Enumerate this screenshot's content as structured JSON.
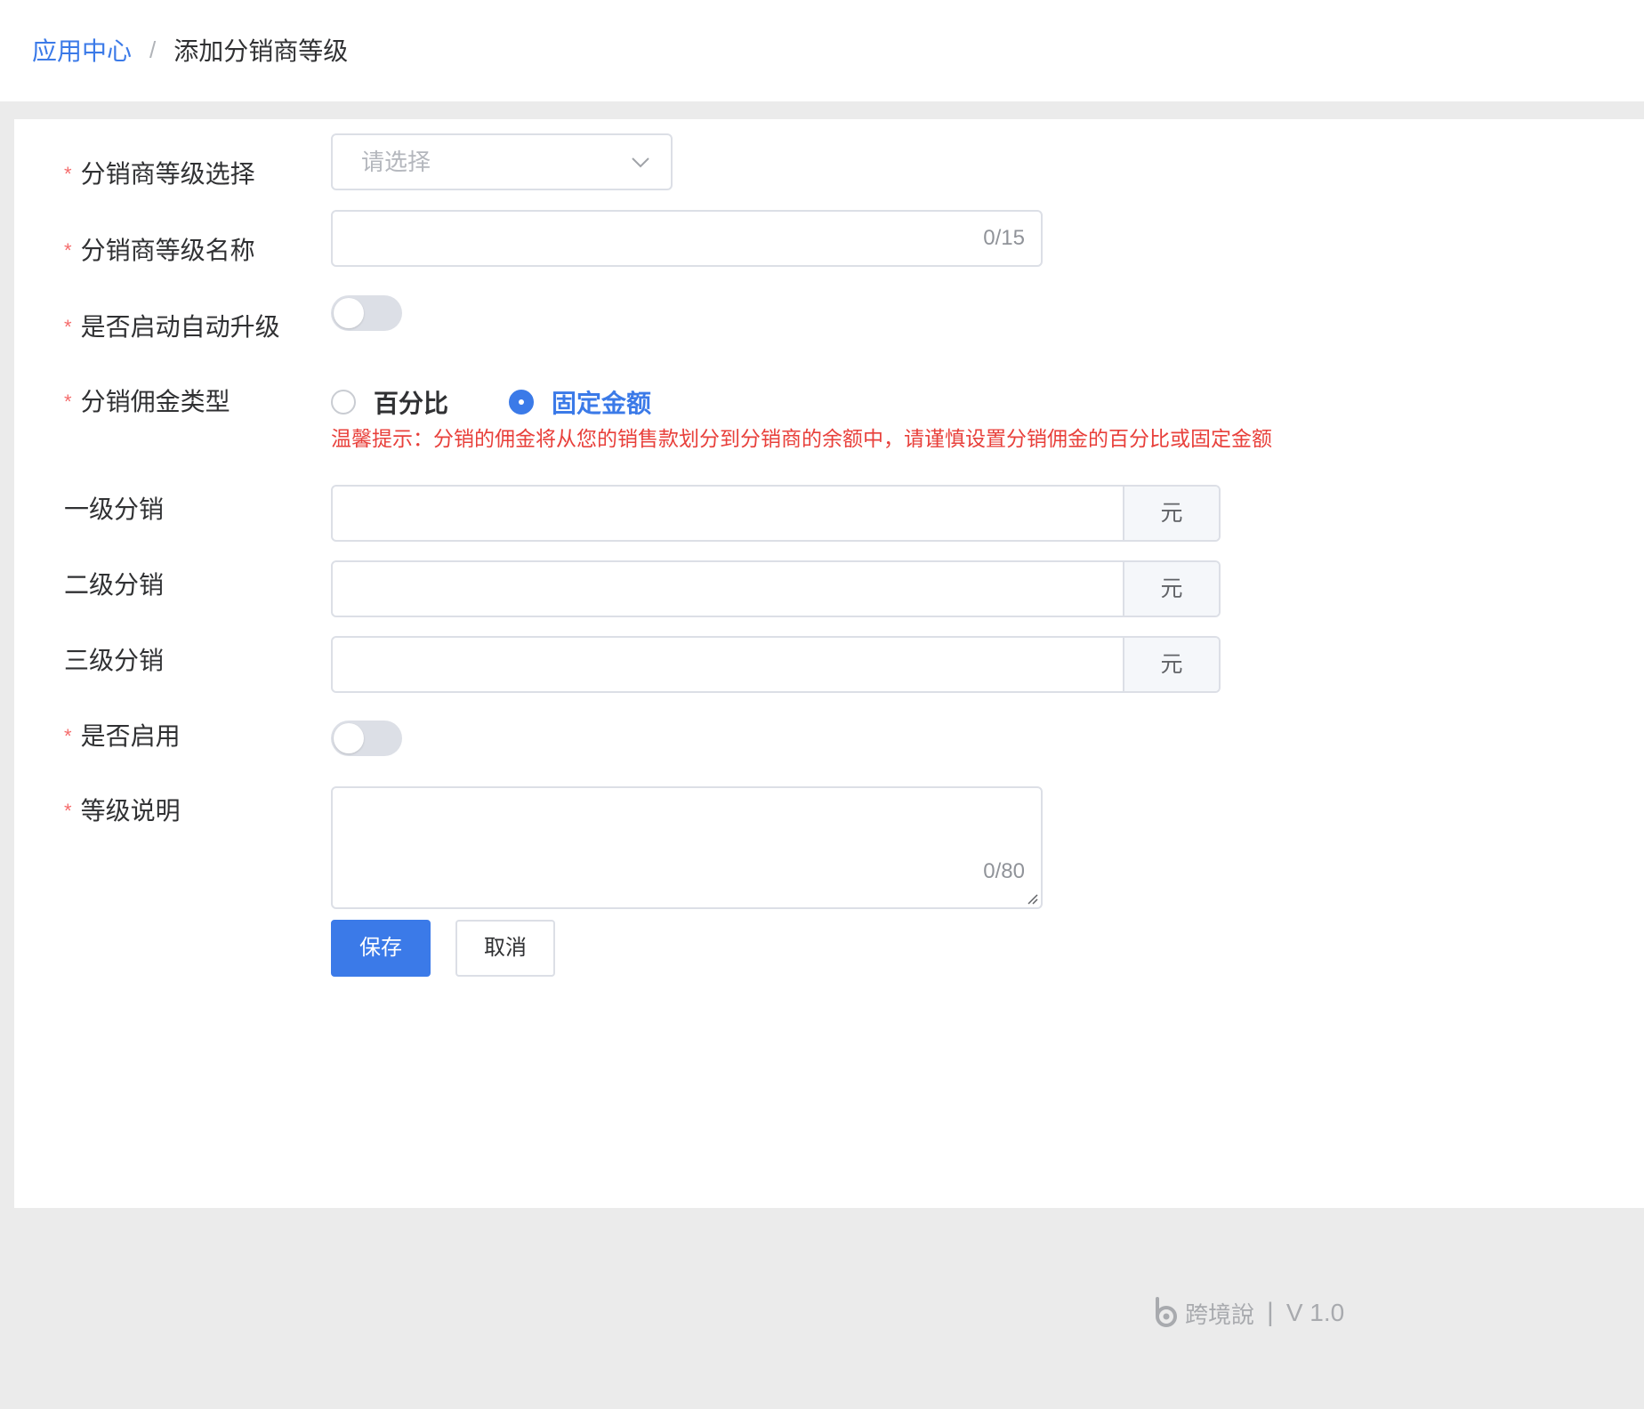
{
  "breadcrumb": {
    "parent": "应用中心",
    "separator": "/",
    "current": "添加分销商等级"
  },
  "form": {
    "required_mark": "*",
    "level_select": {
      "label": "分销商等级选择",
      "placeholder": "请选择"
    },
    "level_name": {
      "label": "分销商等级名称",
      "value": "",
      "counter": "0/15"
    },
    "auto_upgrade": {
      "label": "是否启动自动升级",
      "on": false
    },
    "commission_type": {
      "label": "分销佣金类型",
      "options": [
        "百分比",
        "固定金额"
      ],
      "selected": "固定金额"
    },
    "tip": "温馨提示：分销的佣金将从您的销售款划分到分销商的余额中，请谨慎设置分销佣金的百分比或固定金额",
    "level1": {
      "label": "一级分销",
      "value": "",
      "unit": "元"
    },
    "level2": {
      "label": "二级分销",
      "value": "",
      "unit": "元"
    },
    "level3": {
      "label": "三级分销",
      "value": "",
      "unit": "元"
    },
    "enabled": {
      "label": "是否启用",
      "on": false
    },
    "description": {
      "label": "等级说明",
      "value": "",
      "counter": "0/80"
    }
  },
  "actions": {
    "save": "保存",
    "cancel": "取消"
  },
  "footer": {
    "brand": "跨境說",
    "separator": "|",
    "version": "V 1.0"
  },
  "colors": {
    "primary": "#3b7ae8",
    "danger": "#e8403b",
    "required": "#f56c6c"
  },
  "icons": {
    "select_arrow": "chevron-down-icon",
    "footer_logo": "brand-logo-icon"
  }
}
